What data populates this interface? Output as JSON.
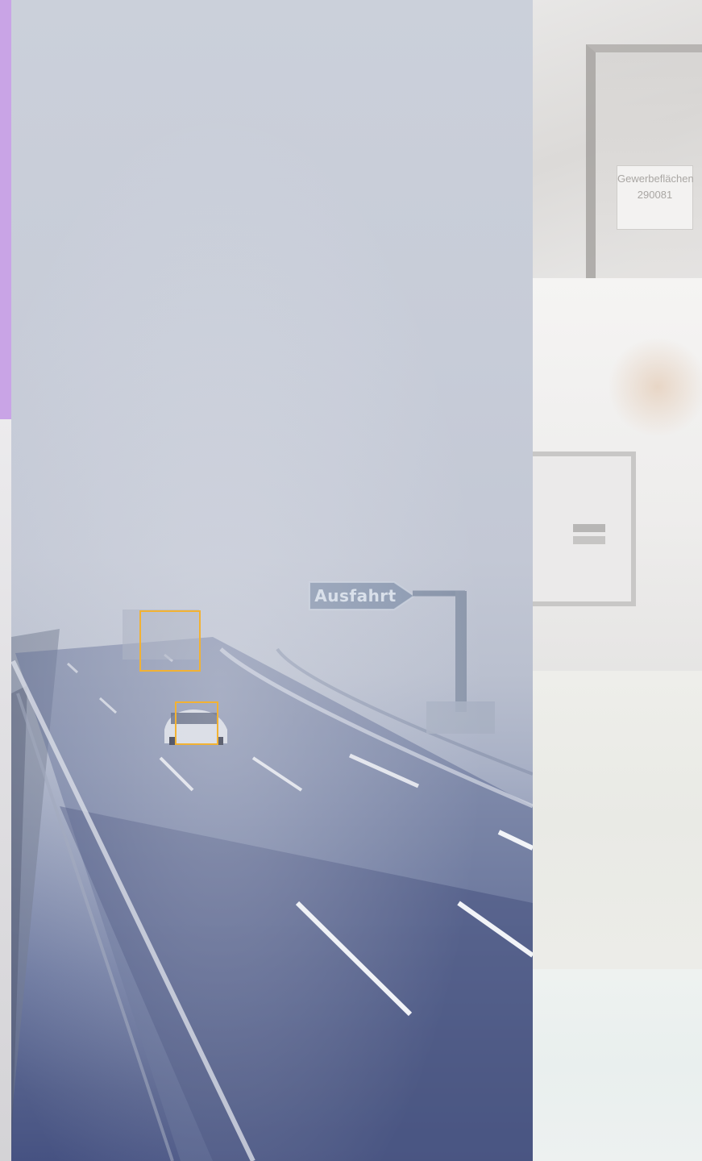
{
  "hero": {
    "sign_text": "Ausfahrt",
    "detections": [
      {
        "label": "truck-detection",
        "color": "#f2b233"
      },
      {
        "label": "car-detection",
        "color": "#f2b233"
      }
    ]
  },
  "side_gallery": {
    "plate_lines": [
      "Gewerbeflächen",
      "290081"
    ]
  },
  "colors": {
    "accent_strip": "#c9a4e6",
    "detection_box": "#f2b233",
    "fog_top": "#cbd0da",
    "road_bottom": "#465282"
  }
}
